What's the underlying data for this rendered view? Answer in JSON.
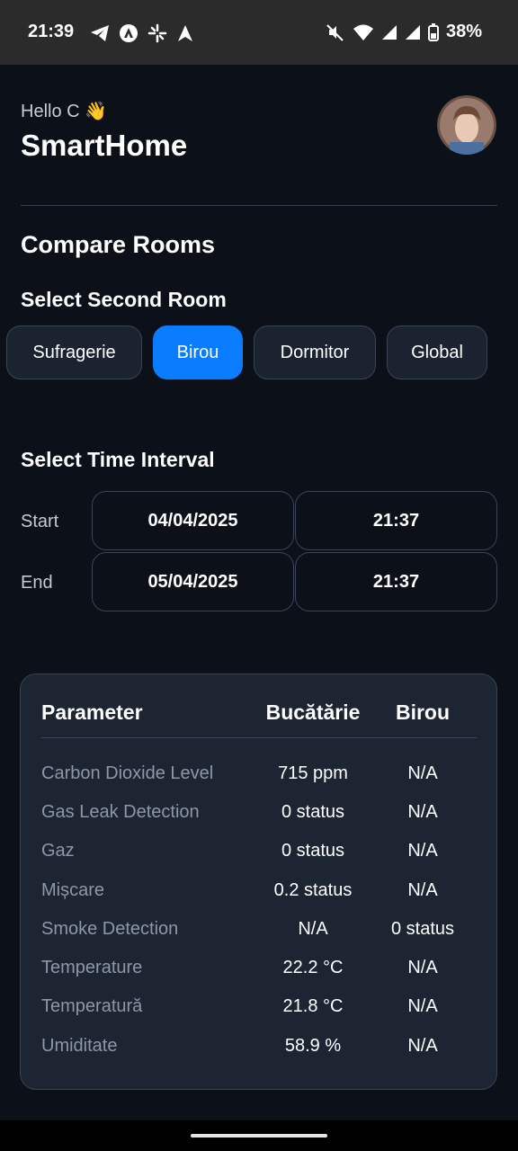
{
  "status_bar": {
    "time": "21:39",
    "battery": "38%",
    "left_icons": [
      "telegram-icon",
      "app-icon",
      "pinwheel-icon",
      "navigation-icon"
    ],
    "right_icons": [
      "mute-icon",
      "wifi-icon",
      "signal-icon",
      "signal-icon",
      "battery-icon"
    ]
  },
  "header": {
    "greeting": "Hello C 👋",
    "app_title": "SmartHome"
  },
  "page_title": "Compare Rooms",
  "room_select": {
    "label": "Select Second Room",
    "chips": [
      "Sufragerie",
      "Birou",
      "Dormitor",
      "Global"
    ],
    "selected": "Birou"
  },
  "time_interval": {
    "label": "Select Time Interval",
    "start_label": "Start",
    "start_date": "04/04/2025",
    "start_time": "21:37",
    "end_label": "End",
    "end_date": "05/04/2025",
    "end_time": "21:37"
  },
  "table": {
    "headers": [
      "Parameter",
      "Bucătărie",
      "Birou"
    ],
    "rows": [
      [
        "Carbon Dioxide Level",
        "715 ppm",
        "N/A"
      ],
      [
        "Gas Leak Detection",
        "0 status",
        "N/A"
      ],
      [
        "Gaz",
        "0 status",
        "N/A"
      ],
      [
        "Mișcare",
        "0.2 status",
        "N/A"
      ],
      [
        "Smoke Detection",
        "N/A",
        "0 status"
      ],
      [
        "Temperature",
        "22.2 °C",
        "N/A"
      ],
      [
        "Temperatură",
        "21.8 °C",
        "N/A"
      ],
      [
        "Umiditate",
        "58.9 %",
        "N/A"
      ]
    ]
  },
  "colors": {
    "background": "#0c1119",
    "accent": "#0a7cff",
    "card": "#1d2533",
    "muted_text": "#8e97a6"
  }
}
